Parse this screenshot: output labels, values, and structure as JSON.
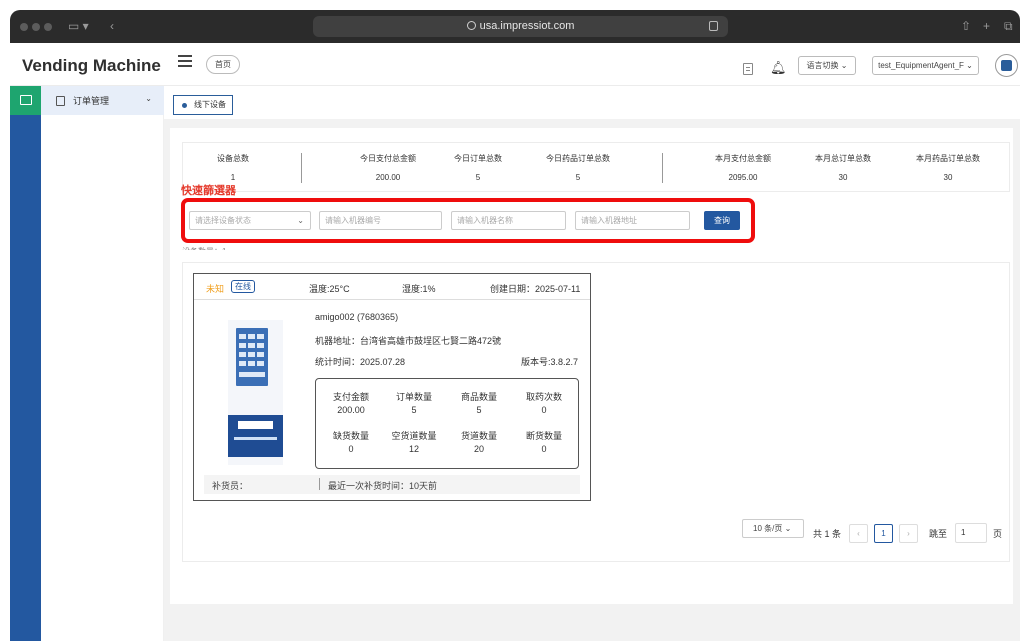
{
  "browser": {
    "url": "usa.impressiot.com"
  },
  "header": {
    "brand": "Vending Machine",
    "home_tab": "首页",
    "language_select": "语言切换",
    "user_select": "test_EquipmentAgent_F"
  },
  "sidebar": {
    "items": [
      {
        "label": "订单管理"
      }
    ]
  },
  "tags": [
    {
      "label": "线下设备"
    }
  ],
  "stats": [
    {
      "label": "设备总数",
      "value": "1"
    },
    {
      "label": "今日支付总金额",
      "value": "200.00"
    },
    {
      "label": "今日订单总数",
      "value": "5"
    },
    {
      "label": "今日药品订单总数",
      "value": "5"
    },
    {
      "label": "本月支付总金额",
      "value": "2095.00"
    },
    {
      "label": "本月总订单总数",
      "value": "30"
    },
    {
      "label": "本月药品订单总数",
      "value": "30"
    }
  ],
  "quick_filter": {
    "title": "快速篩選器",
    "status_placeholder": "请选择设备状态",
    "machine_no_placeholder": "请输入机器编号",
    "machine_name_placeholder": "请输入机器名称",
    "machine_addr_placeholder": "请输入机器地址",
    "query_label": "查询"
  },
  "device_card": {
    "status": "未知",
    "online_badge": "在线",
    "temperature": "温度:25°C",
    "humidity": "湿度:1%",
    "created": "创建日期：2025-07-11",
    "name": "amigo002 (7680365)",
    "address": "机器地址：台湾省高雄市鼓埕区七賢二路472號",
    "stat_time": "统计时间：2025.07.28",
    "version": "版本号:3.8.2.7",
    "metrics": [
      {
        "label": "支付金额",
        "value": "200.00"
      },
      {
        "label": "订单数量",
        "value": "5"
      },
      {
        "label": "商品数量",
        "value": "5"
      },
      {
        "label": "取药次数",
        "value": "0"
      },
      {
        "label": "缺货数量",
        "value": "0"
      },
      {
        "label": "空货道数量",
        "value": "12"
      },
      {
        "label": "货道数量",
        "value": "20"
      },
      {
        "label": "断货数量",
        "value": "0"
      }
    ],
    "restocker": "补货员：",
    "last_restock": "最近一次补货时间：10天前"
  },
  "pagination": {
    "page_size": "10 条/页",
    "total": "共 1 条",
    "current_page": "1",
    "prev": "‹",
    "next": "›",
    "jump_label": "跳至",
    "jump_value": "1",
    "page_unit": "页"
  }
}
